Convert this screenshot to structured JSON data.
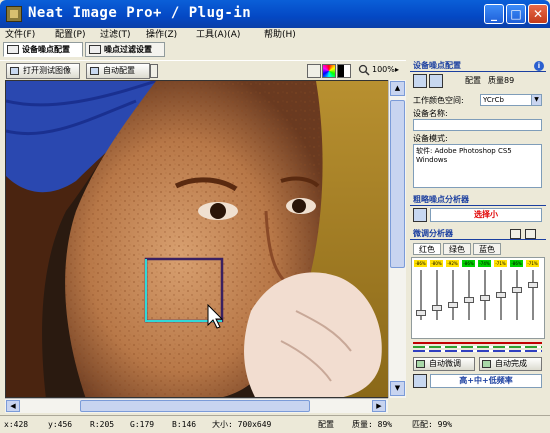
{
  "window": {
    "title": "Neat Image Pro+ / Plug-in",
    "minimize_glyph": "_",
    "maximize_glyph": "□",
    "close_glyph": "✕"
  },
  "menu": [
    {
      "label": "文件(F)"
    },
    {
      "label": "配置(P)"
    },
    {
      "label": "过滤(T)"
    },
    {
      "label": "操作(Z)"
    },
    {
      "label": "工具(A)(A)"
    },
    {
      "label": "帮助(H)"
    }
  ],
  "tabs": [
    {
      "label": "设备噪点配置",
      "active": true
    },
    {
      "label": "噪点过滤设置",
      "active": false
    }
  ],
  "toolbar": {
    "open_image_label": "打开测试图像",
    "auto_profile_label": "自动配置",
    "zoom_value": "100%",
    "zoom_arrow": "▸"
  },
  "panel": {
    "device_profile_title": "设备噪点配置",
    "info_glyph": "i",
    "profile_label": "配置",
    "quality_label": "质量89",
    "color_space_label": "工作颜色空间:",
    "color_space_value": "YCrCb",
    "device_name_label": "设备名称:",
    "device_name_value": "",
    "device_mode_label": "设备模式:",
    "device_mode_value": "软件: Adobe Photoshop CS5\nWindows",
    "rough_analyzer_title": "粗略噪点分析器",
    "rough_result": "选择小",
    "fine_analyzer_title": "微调分析器",
    "channel_tabs": [
      "红色",
      "绿色",
      "蓝色"
    ],
    "slider_percents": [
      "-86%",
      "-80%",
      "-92%",
      "-86%",
      "-74%",
      "-71%",
      "-86%",
      "-71%"
    ],
    "auto_fine_tune_label": "自动微调",
    "auto_complete_label": "自动完成",
    "frequency_label": "高+中+低频率",
    "slider_levels": [
      0.15,
      0.25,
      0.3,
      0.4,
      0.45,
      0.5,
      0.6,
      0.7
    ]
  },
  "status": {
    "x": "x:428",
    "y": "y:456",
    "r": "R:205",
    "g": "G:179",
    "b": "B:146",
    "size": "大小: 700x649",
    "profile": "配置",
    "quality": "质量: 89%",
    "match": "匹配: 99%"
  },
  "colors": {
    "accent": "#1b3fa0",
    "selection_box": "#3a2060",
    "selection_cyan": "#30d8d8",
    "warning_red": "#e00000"
  }
}
